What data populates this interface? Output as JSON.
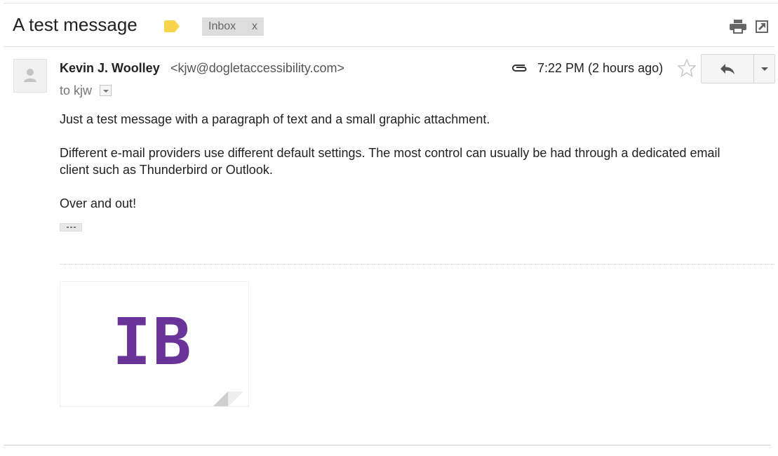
{
  "thread": {
    "subject": "A test message",
    "label_chip": "Inbox",
    "label_chip_remove": "x",
    "label_color": "#f8d44c"
  },
  "message": {
    "sender_name": "Kevin J. Woolley",
    "sender_email": "<kjw@dogletaccessibility.com>",
    "to_line": "to kjw",
    "timestamp": "7:22 PM (2 hours ago)",
    "paragraphs": [
      "Just a test message with a paragraph of text and a small graphic attachment.",
      "Different e-mail providers use different default settings. The most control can usually be had through a dedicated email client such as Thunderbird or Outlook.",
      "Over and out!"
    ]
  },
  "attachment": {
    "preview_text": "IB",
    "preview_color": "#6a3399"
  },
  "icons": {
    "label": "label-tag-icon",
    "print": "printer-icon",
    "popout": "open-in-new-window-icon",
    "avatar": "person-icon",
    "attachment": "paperclip-icon",
    "star": "star-outline-icon",
    "reply": "reply-arrow-icon",
    "more": "chevron-down-icon"
  }
}
